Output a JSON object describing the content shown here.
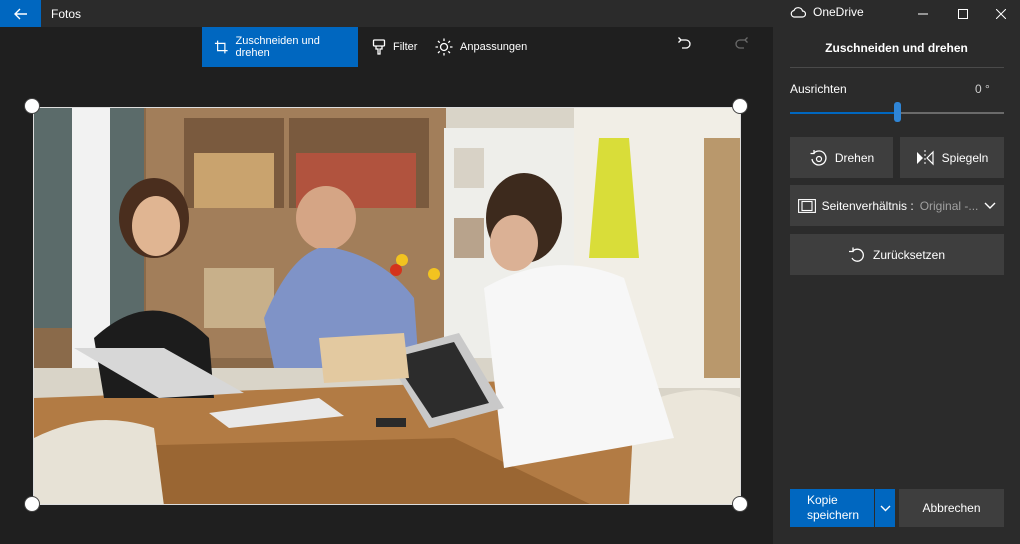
{
  "window": {
    "app_title": "Fotos",
    "onedrive_label": "OneDrive"
  },
  "toolbar": {
    "crop_label": "Zuschneiden und drehen",
    "filter_label": "Filter",
    "adjust_label": "Anpassungen"
  },
  "photo": {
    "description_icon": "meeting-photo"
  },
  "panel": {
    "title": "Zuschneiden und drehen",
    "straighten_label": "Ausrichten",
    "straighten_value": "0 °",
    "straighten_level": 0.5,
    "rotate_label": "Drehen",
    "flip_label": "Spiegeln",
    "aspect_label": "Seitenverhältnis :",
    "aspect_value": "Original -...",
    "reset_label": "Zurücksetzen",
    "save_label_line1": "Kopie",
    "save_label_line2": "speichern",
    "cancel_label": "Abbrechen"
  },
  "colors": {
    "accent": "#0067c0",
    "panel_bg": "#2b2b2b",
    "canvas_bg": "#1f1f1f",
    "button_bg": "#3e3e3e"
  }
}
